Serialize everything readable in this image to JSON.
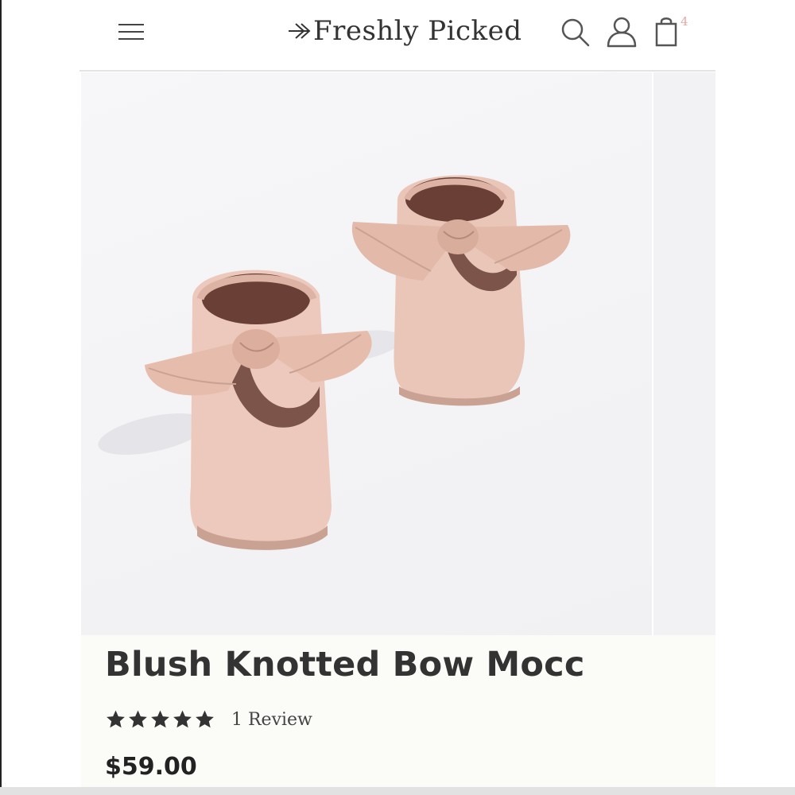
{
  "header": {
    "brand_name": "Freshly Picked",
    "menu_icon": "hamburger-menu-icon",
    "search_icon": "search-icon",
    "account_icon": "user-icon",
    "cart_icon": "shopping-bag-icon",
    "cart_count": "4"
  },
  "product": {
    "title": "Blush Knotted Bow Mocc",
    "rating": 5,
    "rating_max": 5,
    "review_count_label": "1 Review",
    "price": "$59.00",
    "image_icon": "product-photo"
  },
  "colors": {
    "blush": "#e9c6b8",
    "blush_shadow": "#caa294",
    "lining": "#6a4036",
    "cart_badge": "#e8a6a6",
    "text": "#333333"
  }
}
